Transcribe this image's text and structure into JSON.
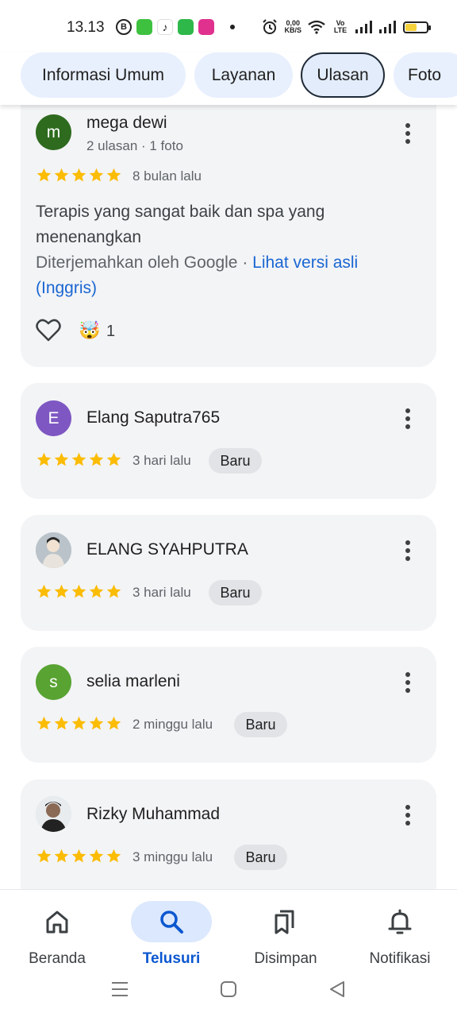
{
  "status": {
    "time": "13.13",
    "speed_value": "0,00",
    "speed_unit": "KB/S",
    "volte": "Vo LTE",
    "battery_level": 0.55
  },
  "tabs": [
    {
      "label": "Informasi Umum",
      "active": false
    },
    {
      "label": "Layanan",
      "active": false
    },
    {
      "label": "Ulasan",
      "active": true
    },
    {
      "label": "Foto",
      "active": false
    }
  ],
  "reviews": [
    {
      "avatar_letter": "m",
      "avatar_color": "#2e6b1f",
      "name": "mega dewi",
      "meta": "2 ulasan · 1 foto",
      "rating": 5,
      "date": "8 bulan lalu",
      "text": "Terapis yang sangat baik dan spa yang menenangkan",
      "translated_prefix": "Diterjemahkan oleh Google · ",
      "translated_link": "Lihat versi asli (Inggris)",
      "reaction_emoji": "🤯",
      "reaction_count": "1"
    },
    {
      "avatar_letter": "E",
      "avatar_color": "#7e57c2",
      "name": "Elang Saputra765",
      "rating": 5,
      "date": "3 hari lalu",
      "badge": "Baru"
    },
    {
      "avatar_letter": "",
      "avatar_color": "#c9ced6",
      "name": "ELANG SYAHPUTRA",
      "rating": 5,
      "date": "3 hari lalu",
      "badge": "Baru"
    },
    {
      "avatar_letter": "s",
      "avatar_color": "#58a332",
      "name": "selia marleni",
      "rating": 5,
      "date": "2 minggu lalu",
      "badge": "Baru"
    },
    {
      "avatar_letter": "",
      "avatar_color": "#c9ced6",
      "name": "Rizky Muhammad",
      "rating": 5,
      "date": "3 minggu lalu",
      "badge": "Baru"
    }
  ],
  "nav": [
    {
      "label": "Beranda",
      "icon": "home-icon",
      "active": false
    },
    {
      "label": "Telusuri",
      "icon": "search-icon",
      "active": true
    },
    {
      "label": "Disimpan",
      "icon": "bookmarks-icon",
      "active": false
    },
    {
      "label": "Notifikasi",
      "icon": "bell-icon",
      "active": false
    }
  ],
  "colors": {
    "star": "#fbbc04",
    "link": "#1a66d2",
    "active_nav": "#0b57d0"
  }
}
